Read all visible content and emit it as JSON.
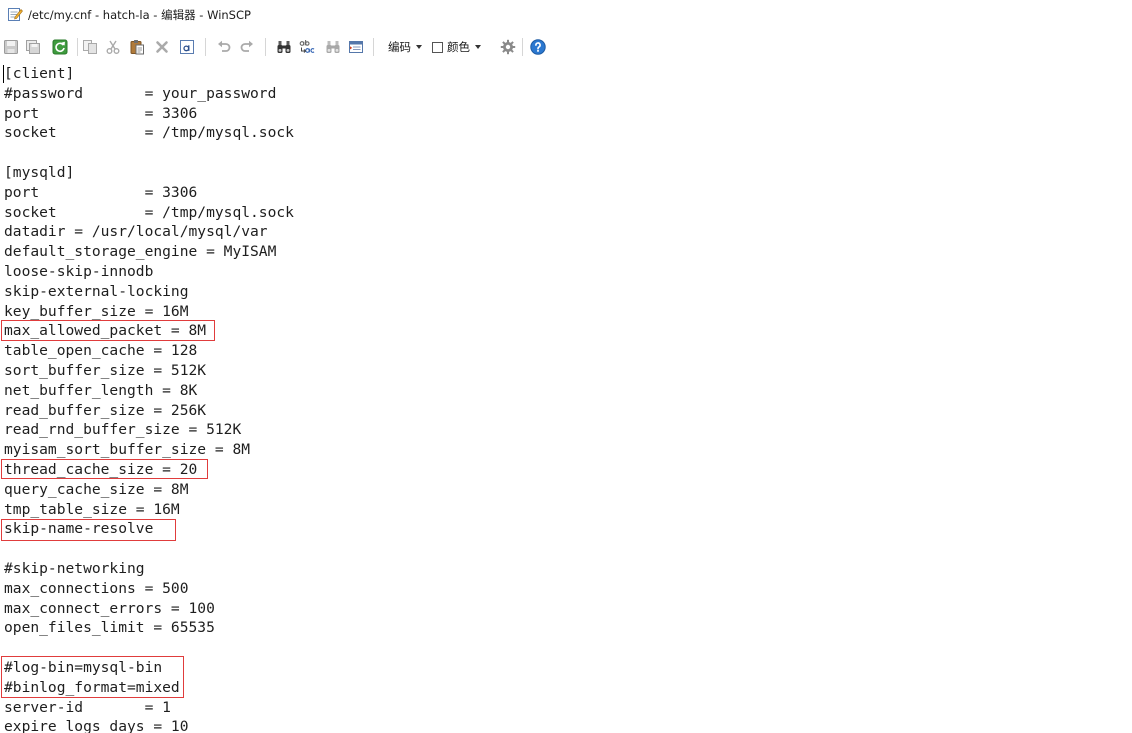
{
  "window": {
    "title": "/etc/my.cnf - hatch-la - 编辑器 - WinSCP",
    "icon": "edit-document-icon"
  },
  "toolbar": {
    "buttons": [
      {
        "icon": "save-icon",
        "enabled": false
      },
      {
        "icon": "save-all-icon",
        "enabled": false
      },
      {
        "icon": "reload-icon",
        "enabled": true
      },
      {
        "icon": "copy-icon",
        "enabled": false
      },
      {
        "icon": "cut-icon",
        "enabled": false
      },
      {
        "icon": "paste-icon",
        "enabled": true
      },
      {
        "icon": "delete-icon",
        "enabled": false
      },
      {
        "icon": "select-all-icon",
        "enabled": true
      },
      {
        "icon": "undo-icon",
        "enabled": false
      },
      {
        "icon": "redo-icon",
        "enabled": false
      },
      {
        "icon": "find-icon",
        "enabled": true
      },
      {
        "icon": "replace-icon",
        "enabled": true
      },
      {
        "icon": "find-next-icon",
        "enabled": false
      },
      {
        "icon": "goto-line-icon",
        "enabled": true
      },
      {
        "icon": "gear-icon",
        "enabled": true
      },
      {
        "icon": "help-icon",
        "enabled": true
      }
    ],
    "encoding_label": "编码",
    "color_label": "颜色",
    "color_checked": false
  },
  "editor": {
    "lines": [
      "[client]",
      "#password       = your_password",
      "port            = 3306",
      "socket          = /tmp/mysql.sock",
      "",
      "[mysqld]",
      "port            = 3306",
      "socket          = /tmp/mysql.sock",
      "datadir = /usr/local/mysql/var",
      "default_storage_engine = MyISAM",
      "loose-skip-innodb",
      "skip-external-locking",
      "key_buffer_size = 16M",
      "max_allowed_packet = 8M",
      "table_open_cache = 128",
      "sort_buffer_size = 512K",
      "net_buffer_length = 8K",
      "read_buffer_size = 256K",
      "read_rnd_buffer_size = 512K",
      "myisam_sort_buffer_size = 8M",
      "thread_cache_size = 20",
      "query_cache_size = 8M",
      "tmp_table_size = 16M",
      "skip-name-resolve",
      "",
      "#skip-networking",
      "max_connections = 500",
      "max_connect_errors = 100",
      "open_files_limit = 65535",
      "",
      "#log-bin=mysql-bin",
      "#binlog_format=mixed",
      "server-id       = 1",
      "expire_logs_days = 10"
    ]
  },
  "colors": {
    "annotation_box": "#e03c3c",
    "reload": "#3e9b3e",
    "help": "#2b78d0",
    "text": "#1e1e1e"
  }
}
